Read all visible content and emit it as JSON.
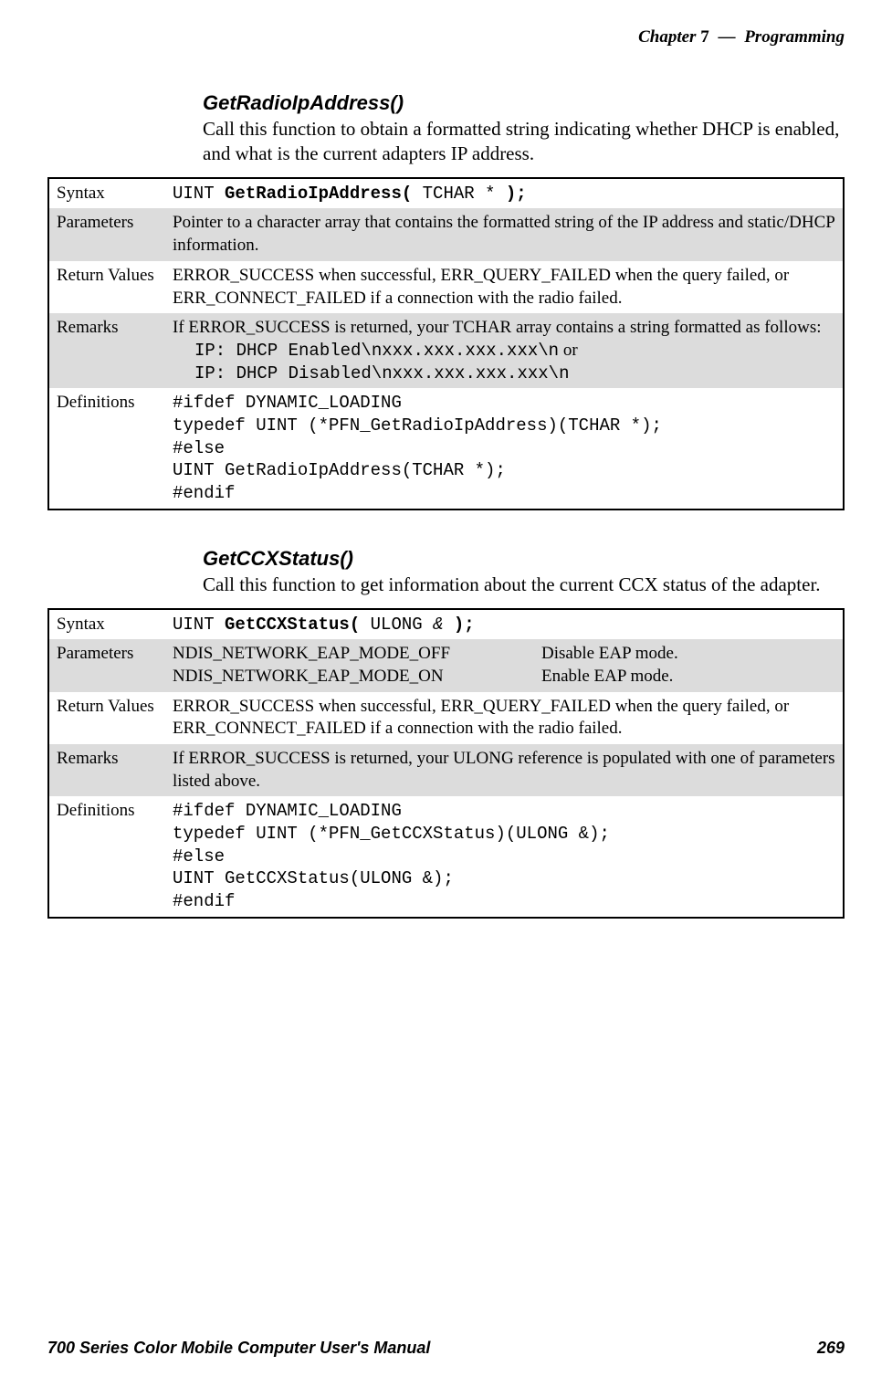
{
  "header": {
    "chapter_label": "Chapter",
    "chapter_number": "7",
    "dash": "—",
    "title": "Programming"
  },
  "sections": [
    {
      "heading": "GetRadioIpAddress()",
      "description": "Call this function to obtain a formatted string indicating whether DHCP is enabled, and what is the current adapters IP address.",
      "rows": {
        "syntax_label": "Syntax",
        "syntax_pre": "UINT ",
        "syntax_bold1": "GetRadioIpAddress(",
        "syntax_mid": " TCHAR * ",
        "syntax_bold2": ");",
        "parameters_label": "Parameters",
        "parameters_text": "Pointer to a character array that contains the formatted string of the IP address and static/DHCP information.",
        "return_label": "Return Values",
        "return_text": "ERROR_SUCCESS when successful, ERR_QUERY_FAILED when the query failed, or ERR_CONNECT_FAILED if a connection with the radio failed.",
        "remarks_label": "Remarks",
        "remarks_intro": "If ERROR_SUCCESS is returned, your TCHAR array contains a string formatted as follows:",
        "remarks_code1": "IP: DHCP Enabled\\nxxx.xxx.xxx.xxx\\n",
        "remarks_or": " or",
        "remarks_code2": "IP: DHCP Disabled\\nxxx.xxx.xxx.xxx\\n",
        "definitions_label": "Definitions",
        "definitions_code": "#ifdef DYNAMIC_LOADING\ntypedef UINT (*PFN_GetRadioIpAddress)(TCHAR *);\n#else\nUINT GetRadioIpAddress(TCHAR *);\n#endif"
      }
    },
    {
      "heading": "GetCCXStatus()",
      "description": "Call this function to get information about the current CCX status of the adapter.",
      "rows": {
        "syntax_label": "Syntax",
        "syntax_pre": "UINT ",
        "syntax_bold1": "GetCCXStatus(",
        "syntax_mid": " ULONG ",
        "syntax_italic": "&",
        "syntax_bold2": " );",
        "parameters_label": "Parameters",
        "param1_name": "NDIS_NETWORK_EAP_MODE_OFF",
        "param1_desc": "Disable EAP mode.",
        "param2_name": "NDIS_NETWORK_EAP_MODE_ON",
        "param2_desc": "Enable EAP mode.",
        "return_label": "Return Values",
        "return_text": "ERROR_SUCCESS when successful, ERR_QUERY_FAILED when the query failed, or ERR_CONNECT_FAILED if a connection with the radio failed.",
        "remarks_label": "Remarks",
        "remarks_text": "If ERROR_SUCCESS is returned, your ULONG reference is populated with one of parameters listed above.",
        "definitions_label": "Definitions",
        "definitions_code": "#ifdef DYNAMIC_LOADING\ntypedef UINT (*PFN_GetCCXStatus)(ULONG &);\n#else\nUINT GetCCXStatus(ULONG &);\n#endif"
      }
    }
  ],
  "footer": {
    "left": "700 Series Color Mobile Computer User's Manual",
    "right": "269"
  }
}
